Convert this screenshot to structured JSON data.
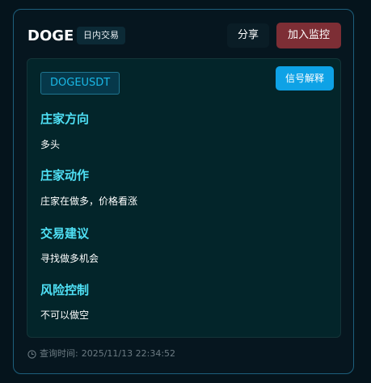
{
  "header": {
    "symbol": "DOGE",
    "badge": "日内交易",
    "share_label": "分享",
    "monitor_label": "加入监控"
  },
  "panel": {
    "pair": "DOGEUSDT",
    "explain_label": "信号解释",
    "sections": [
      {
        "title": "庄家方向",
        "value": "多头"
      },
      {
        "title": "庄家动作",
        "value": "庄家在做多，价格看涨"
      },
      {
        "title": "交易建议",
        "value": "寻找做多机会"
      },
      {
        "title": "风险控制",
        "value": "不可以做空"
      }
    ]
  },
  "footer": {
    "label": "查询时间:",
    "time": "2025/11/13 22:34:52"
  },
  "colors": {
    "accent": "#4fe0f5",
    "monitor_button": "#7d2e35",
    "explain_button": "#0ea2e6"
  },
  "icons": {
    "footer_icon": "clock-icon"
  }
}
